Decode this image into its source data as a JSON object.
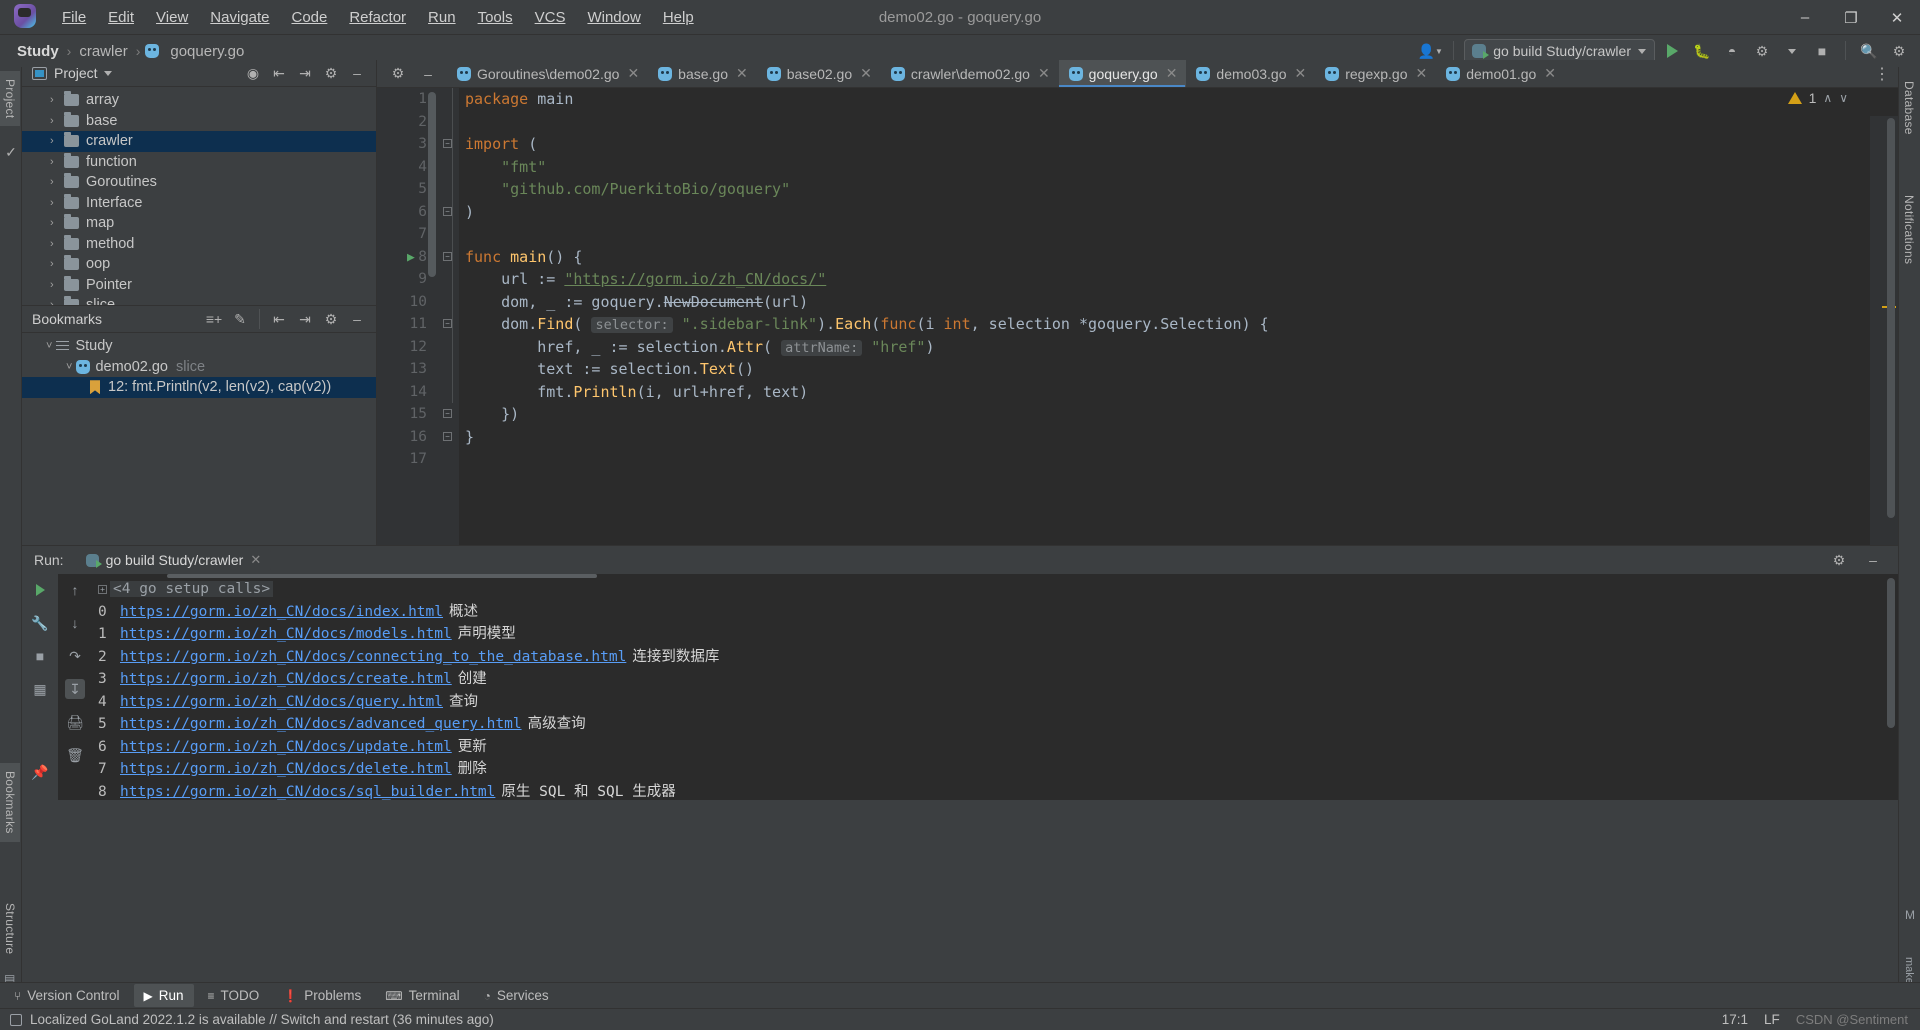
{
  "window": {
    "title": "demo02.go - goquery.go",
    "minimize_label": "–",
    "maximize_label": "❐",
    "close_label": "✕"
  },
  "menu": [
    {
      "label": "File"
    },
    {
      "label": "Edit"
    },
    {
      "label": "View"
    },
    {
      "label": "Navigate"
    },
    {
      "label": "Code"
    },
    {
      "label": "Refactor"
    },
    {
      "label": "Run"
    },
    {
      "label": "Tools"
    },
    {
      "label": "VCS"
    },
    {
      "label": "Window"
    },
    {
      "label": "Help"
    }
  ],
  "breadcrumb": {
    "project": "Study",
    "folder": "crawler",
    "file": "goquery.go",
    "separator": "›"
  },
  "navbar": {
    "run_config": "go build Study/crawler",
    "run_button": "run-button",
    "debug_button": "debug-button",
    "coverage_button": "coverage-button",
    "profile_button": "profile-button",
    "stop_button": "stop-button",
    "search_button": "search-everywhere",
    "settings_button": "settings"
  },
  "left_strips": [
    {
      "label": "Project"
    },
    {
      "label": "Bookmarks"
    },
    {
      "label": "Structure"
    }
  ],
  "right_strips": [
    {
      "label": "Database"
    },
    {
      "label": "Notifications"
    }
  ],
  "project_panel": {
    "title": "Project",
    "items": [
      {
        "label": "array",
        "selected": false
      },
      {
        "label": "base",
        "selected": false
      },
      {
        "label": "crawler",
        "selected": true
      },
      {
        "label": "function",
        "selected": false
      },
      {
        "label": "Goroutines",
        "selected": false
      },
      {
        "label": "Interface",
        "selected": false
      },
      {
        "label": "map",
        "selected": false
      },
      {
        "label": "method",
        "selected": false
      },
      {
        "label": "oop",
        "selected": false
      },
      {
        "label": "Pointer",
        "selected": false
      },
      {
        "label": "slice",
        "selected": false
      }
    ]
  },
  "bookmarks_panel": {
    "title": "Bookmarks",
    "root": "Study",
    "file": "demo02.go",
    "file_hint": "slice",
    "entry": "12: fmt.Println(v2, len(v2), cap(v2))"
  },
  "editor": {
    "tabs": [
      {
        "label": "Goroutines\\demo02.go",
        "active": false
      },
      {
        "label": "base.go",
        "active": false
      },
      {
        "label": "base02.go",
        "active": false
      },
      {
        "label": "crawler\\demo02.go",
        "active": false
      },
      {
        "label": "goquery.go",
        "active": true
      },
      {
        "label": "demo03.go",
        "active": false
      },
      {
        "label": "regexp.go",
        "active": false
      },
      {
        "label": "demo01.go",
        "active": false
      }
    ],
    "warning_count": "1",
    "line_numbers": [
      "1",
      "2",
      "3",
      "4",
      "5",
      "6",
      "7",
      "8",
      "9",
      "10",
      "11",
      "12",
      "13",
      "14",
      "15",
      "16",
      "17"
    ],
    "code_lines": [
      {
        "n": 1,
        "tokens": [
          {
            "t": "package ",
            "c": "kw"
          },
          {
            "t": "main",
            "c": "plain"
          }
        ]
      },
      {
        "n": 2,
        "tokens": []
      },
      {
        "n": 3,
        "tokens": [
          {
            "t": "import ",
            "c": "kw"
          },
          {
            "t": "(",
            "c": "plain"
          }
        ]
      },
      {
        "n": 4,
        "tokens": [
          {
            "t": "    \"fmt\"",
            "c": "str"
          }
        ]
      },
      {
        "n": 5,
        "tokens": [
          {
            "t": "    \"github.com/PuerkitoBio/goquery\"",
            "c": "str"
          }
        ]
      },
      {
        "n": 6,
        "tokens": [
          {
            "t": ")",
            "c": "plain"
          }
        ]
      },
      {
        "n": 7,
        "tokens": []
      },
      {
        "n": 8,
        "tokens": [
          {
            "t": "func ",
            "c": "kw"
          },
          {
            "t": "main",
            "c": "fn"
          },
          {
            "t": "() {",
            "c": "plain"
          }
        ]
      },
      {
        "n": 9,
        "tokens": [
          {
            "t": "    url := ",
            "c": "plain"
          },
          {
            "t": "\"https://gorm.io/zh_CN/docs/\"",
            "c": "url-str"
          }
        ]
      },
      {
        "n": 10,
        "tokens": [
          {
            "t": "    dom, _ := goquery.",
            "c": "plain"
          },
          {
            "t": "NewDocument",
            "c": "strike"
          },
          {
            "t": "(url)",
            "c": "plain"
          }
        ]
      },
      {
        "n": 11,
        "tokens": [
          {
            "t": "    dom.",
            "c": "plain"
          },
          {
            "t": "Find",
            "c": "fn"
          },
          {
            "t": "( ",
            "c": "plain"
          },
          {
            "t": "selector:",
            "c": "hint"
          },
          {
            "t": " ",
            "c": "plain"
          },
          {
            "t": "\".sidebar-link\"",
            "c": "str"
          },
          {
            "t": ").",
            "c": "plain"
          },
          {
            "t": "Each",
            "c": "fn"
          },
          {
            "t": "(",
            "c": "plain"
          },
          {
            "t": "func",
            "c": "kw"
          },
          {
            "t": "(i ",
            "c": "plain"
          },
          {
            "t": "int",
            "c": "kw"
          },
          {
            "t": ", selection *goquery.",
            "c": "plain"
          },
          {
            "t": "Selection",
            "c": "typ"
          },
          {
            "t": ") {",
            "c": "plain"
          }
        ]
      },
      {
        "n": 12,
        "tokens": [
          {
            "t": "        href, _ := selection.",
            "c": "plain"
          },
          {
            "t": "Attr",
            "c": "fn"
          },
          {
            "t": "( ",
            "c": "plain"
          },
          {
            "t": "attrName:",
            "c": "hint"
          },
          {
            "t": " ",
            "c": "plain"
          },
          {
            "t": "\"href\"",
            "c": "str"
          },
          {
            "t": ")",
            "c": "plain"
          }
        ]
      },
      {
        "n": 13,
        "tokens": [
          {
            "t": "        text := selection.",
            "c": "plain"
          },
          {
            "t": "Text",
            "c": "fn"
          },
          {
            "t": "()",
            "c": "plain"
          }
        ]
      },
      {
        "n": 14,
        "tokens": [
          {
            "t": "        fmt.",
            "c": "plain"
          },
          {
            "t": "Println",
            "c": "fn"
          },
          {
            "t": "(i, url+href, text)",
            "c": "plain"
          }
        ]
      },
      {
        "n": 15,
        "tokens": [
          {
            "t": "    })",
            "c": "plain"
          }
        ]
      },
      {
        "n": 16,
        "tokens": [
          {
            "t": "}",
            "c": "plain"
          }
        ]
      },
      {
        "n": 17,
        "tokens": []
      }
    ]
  },
  "run_panel": {
    "label": "Run:",
    "tab": "go build Study/crawler",
    "setup_line": "<4 go setup calls>",
    "lines": [
      {
        "idx": "0",
        "url": "https://gorm.io/zh_CN/docs/index.html",
        "desc": "概述"
      },
      {
        "idx": "1",
        "url": "https://gorm.io/zh_CN/docs/models.html",
        "desc": "声明模型"
      },
      {
        "idx": "2",
        "url": "https://gorm.io/zh_CN/docs/connecting_to_the_database.html",
        "desc": "连接到数据库"
      },
      {
        "idx": "3",
        "url": "https://gorm.io/zh_CN/docs/create.html",
        "desc": "创建"
      },
      {
        "idx": "4",
        "url": "https://gorm.io/zh_CN/docs/query.html",
        "desc": "查询"
      },
      {
        "idx": "5",
        "url": "https://gorm.io/zh_CN/docs/advanced_query.html",
        "desc": "高级查询"
      },
      {
        "idx": "6",
        "url": "https://gorm.io/zh_CN/docs/update.html",
        "desc": "更新"
      },
      {
        "idx": "7",
        "url": "https://gorm.io/zh_CN/docs/delete.html",
        "desc": "删除"
      },
      {
        "idx": "8",
        "url": "https://gorm.io/zh_CN/docs/sql_builder.html",
        "desc": "原生 SQL 和 SQL 生成器"
      }
    ]
  },
  "bottom_tabs": [
    {
      "label": "Version Control",
      "selected": false,
      "icon": "branch-icon"
    },
    {
      "label": "Run",
      "selected": true,
      "icon": "play-icon"
    },
    {
      "label": "TODO",
      "selected": false,
      "icon": "list-icon"
    },
    {
      "label": "Problems",
      "selected": false,
      "icon": "warning-icon"
    },
    {
      "label": "Terminal",
      "selected": false,
      "icon": "terminal-icon"
    },
    {
      "label": "Services",
      "selected": false,
      "icon": "services-icon"
    }
  ],
  "statusbar": {
    "message": "Localized GoLand 2022.1.2 is available // Switch and restart (36 minutes ago)",
    "caret": "17:1",
    "line_sep": "LF",
    "watermark": "CSDN @Sentiment"
  },
  "colors": {
    "accent": "#4a88c7",
    "selection": "#0d2f4f",
    "link": "#589df6",
    "string": "#6a8759",
    "keyword": "#cc7832",
    "function": "#ffc66d",
    "warning": "#d4a017",
    "run_green": "#59a869"
  }
}
